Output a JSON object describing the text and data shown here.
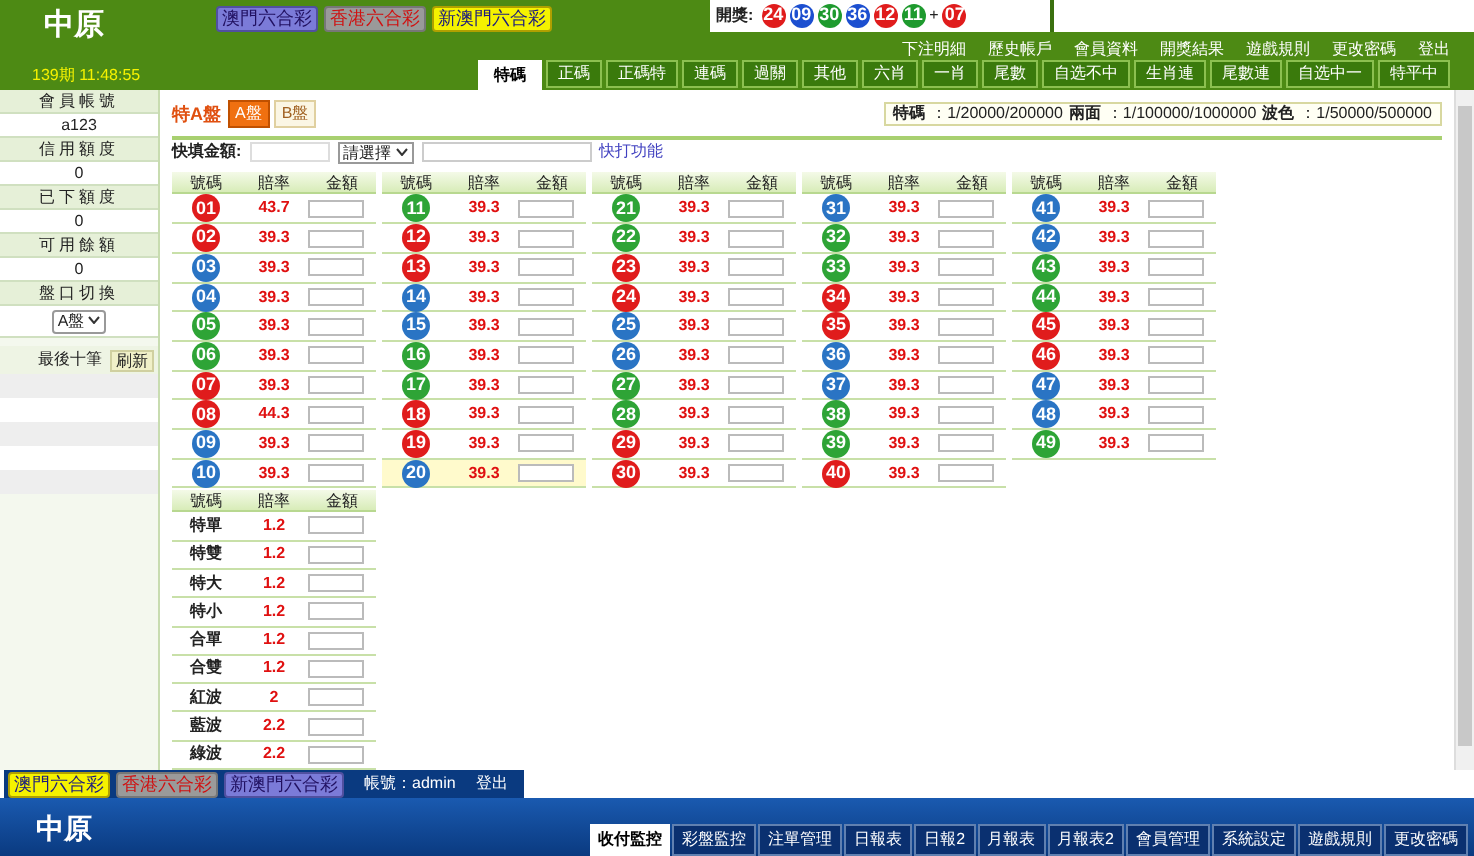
{
  "header": {
    "logo": "中原",
    "period": "139期 11:48:55",
    "lottery_badges": [
      {
        "label": "澳門六合彩",
        "selected": false
      },
      {
        "label": "香港六合彩",
        "selected": false
      },
      {
        "label": "新澳門六合彩",
        "selected": true
      }
    ],
    "draw": {
      "label": "開獎:",
      "plus": "+",
      "balls": [
        {
          "number": "24",
          "color": "#e01c1c"
        },
        {
          "number": "09",
          "color": "#1c4fd0"
        },
        {
          "number": "30",
          "color": "#1e9a2e"
        },
        {
          "number": "36",
          "color": "#1c4fd0"
        },
        {
          "number": "12",
          "color": "#e01c1c"
        },
        {
          "number": "11",
          "color": "#1e9a2e"
        },
        {
          "number": "07",
          "color": "#e01c1c"
        }
      ]
    },
    "links": [
      "下注明細",
      "歷史帳戶",
      "會員資料",
      "開獎結果",
      "遊戲規則",
      "更改密碼",
      "登出"
    ],
    "tabs": [
      {
        "label": "特碼",
        "selected": true
      },
      {
        "label": "正碼",
        "selected": false
      },
      {
        "label": "正碼特",
        "selected": false
      },
      {
        "label": "連碼",
        "selected": false
      },
      {
        "label": "過關",
        "selected": false
      },
      {
        "label": "其他",
        "selected": false
      },
      {
        "label": "六肖",
        "selected": false
      },
      {
        "label": "一肖",
        "selected": false
      },
      {
        "label": "尾數",
        "selected": false
      },
      {
        "label": "自选不中",
        "selected": false
      },
      {
        "label": "生肖連",
        "selected": false
      },
      {
        "label": "尾數連",
        "selected": false
      },
      {
        "label": "自选中一",
        "selected": false
      },
      {
        "label": "特平中",
        "selected": false
      }
    ]
  },
  "sidebar": {
    "fields": [
      {
        "label": "會員帳號",
        "value": "a123"
      },
      {
        "label": "信用額度",
        "value": "0"
      },
      {
        "label": "已下額度",
        "value": "0"
      },
      {
        "label": "可用餘額",
        "value": "0"
      }
    ],
    "plate_switch": {
      "label": "盤口切換",
      "value": "A盤"
    },
    "recent": {
      "title": "最後十筆",
      "button": "刷新"
    }
  },
  "main": {
    "title": "特A盤",
    "plates": [
      {
        "label": "A盤",
        "selected": true
      },
      {
        "label": "B盤",
        "selected": false
      }
    ],
    "quick_fill": {
      "label": "快填金額:",
      "select": "請選擇",
      "link": "快打功能"
    },
    "limits": [
      {
        "label": "特碼",
        "value": "：1/20000/200000"
      },
      {
        "label": "兩面",
        "value": "：1/100000/1000000"
      },
      {
        "label": "波色",
        "value": "：1/50000/500000"
      }
    ],
    "number_tables": [
      {
        "columns": [
          "號碼",
          "賠率",
          "金額"
        ],
        "rows": [
          {
            "number": "01",
            "color": "#e01c1c",
            "odds": "43.7",
            "selected": false
          },
          {
            "number": "02",
            "color": "#e01c1c",
            "odds": "39.3",
            "selected": false
          },
          {
            "number": "03",
            "color": "#2a74c4",
            "odds": "39.3",
            "selected": false
          },
          {
            "number": "04",
            "color": "#2a74c4",
            "odds": "39.3",
            "selected": false
          },
          {
            "number": "05",
            "color": "#2ea436",
            "odds": "39.3",
            "selected": false
          },
          {
            "number": "06",
            "color": "#2ea436",
            "odds": "39.3",
            "selected": false
          },
          {
            "number": "07",
            "color": "#e01c1c",
            "odds": "39.3",
            "selected": false
          },
          {
            "number": "08",
            "color": "#e01c1c",
            "odds": "44.3",
            "selected": false
          },
          {
            "number": "09",
            "color": "#2a74c4",
            "odds": "39.3",
            "selected": false
          },
          {
            "number": "10",
            "color": "#2a74c4",
            "odds": "39.3",
            "selected": false
          }
        ]
      },
      {
        "columns": [
          "號碼",
          "賠率",
          "金額"
        ],
        "rows": [
          {
            "number": "11",
            "color": "#2ea436",
            "odds": "39.3",
            "selected": false
          },
          {
            "number": "12",
            "color": "#e01c1c",
            "odds": "39.3",
            "selected": false
          },
          {
            "number": "13",
            "color": "#e01c1c",
            "odds": "39.3",
            "selected": false
          },
          {
            "number": "14",
            "color": "#2a74c4",
            "odds": "39.3",
            "selected": false
          },
          {
            "number": "15",
            "color": "#2a74c4",
            "odds": "39.3",
            "selected": false
          },
          {
            "number": "16",
            "color": "#2ea436",
            "odds": "39.3",
            "selected": false
          },
          {
            "number": "17",
            "color": "#2ea436",
            "odds": "39.3",
            "selected": false
          },
          {
            "number": "18",
            "color": "#e01c1c",
            "odds": "39.3",
            "selected": false
          },
          {
            "number": "19",
            "color": "#e01c1c",
            "odds": "39.3",
            "selected": false
          },
          {
            "number": "20",
            "color": "#2a74c4",
            "odds": "39.3",
            "selected": true
          }
        ]
      },
      {
        "columns": [
          "號碼",
          "賠率",
          "金額"
        ],
        "rows": [
          {
            "number": "21",
            "color": "#2ea436",
            "odds": "39.3",
            "selected": false
          },
          {
            "number": "22",
            "color": "#2ea436",
            "odds": "39.3",
            "selected": false
          },
          {
            "number": "23",
            "color": "#e01c1c",
            "odds": "39.3",
            "selected": false
          },
          {
            "number": "24",
            "color": "#e01c1c",
            "odds": "39.3",
            "selected": false
          },
          {
            "number": "25",
            "color": "#2a74c4",
            "odds": "39.3",
            "selected": false
          },
          {
            "number": "26",
            "color": "#2a74c4",
            "odds": "39.3",
            "selected": false
          },
          {
            "number": "27",
            "color": "#2ea436",
            "odds": "39.3",
            "selected": false
          },
          {
            "number": "28",
            "color": "#2ea436",
            "odds": "39.3",
            "selected": false
          },
          {
            "number": "29",
            "color": "#e01c1c",
            "odds": "39.3",
            "selected": false
          },
          {
            "number": "30",
            "color": "#e01c1c",
            "odds": "39.3",
            "selected": false
          }
        ]
      },
      {
        "columns": [
          "號碼",
          "賠率",
          "金額"
        ],
        "rows": [
          {
            "number": "31",
            "color": "#2a74c4",
            "odds": "39.3",
            "selected": false
          },
          {
            "number": "32",
            "color": "#2ea436",
            "odds": "39.3",
            "selected": false
          },
          {
            "number": "33",
            "color": "#2ea436",
            "odds": "39.3",
            "selected": false
          },
          {
            "number": "34",
            "color": "#e01c1c",
            "odds": "39.3",
            "selected": false
          },
          {
            "number": "35",
            "color": "#e01c1c",
            "odds": "39.3",
            "selected": false
          },
          {
            "number": "36",
            "color": "#2a74c4",
            "odds": "39.3",
            "selected": false
          },
          {
            "number": "37",
            "color": "#2a74c4",
            "odds": "39.3",
            "selected": false
          },
          {
            "number": "38",
            "color": "#2ea436",
            "odds": "39.3",
            "selected": false
          },
          {
            "number": "39",
            "color": "#2ea436",
            "odds": "39.3",
            "selected": false
          },
          {
            "number": "40",
            "color": "#e01c1c",
            "odds": "39.3",
            "selected": false
          }
        ]
      },
      {
        "columns": [
          "號碼",
          "賠率",
          "金額"
        ],
        "rows": [
          {
            "number": "41",
            "color": "#2a74c4",
            "odds": "39.3",
            "selected": false
          },
          {
            "number": "42",
            "color": "#2a74c4",
            "odds": "39.3",
            "selected": false
          },
          {
            "number": "43",
            "color": "#2ea436",
            "odds": "39.3",
            "selected": false
          },
          {
            "number": "44",
            "color": "#2ea436",
            "odds": "39.3",
            "selected": false
          },
          {
            "number": "45",
            "color": "#e01c1c",
            "odds": "39.3",
            "selected": false
          },
          {
            "number": "46",
            "color": "#e01c1c",
            "odds": "39.3",
            "selected": false
          },
          {
            "number": "47",
            "color": "#2a74c4",
            "odds": "39.3",
            "selected": false
          },
          {
            "number": "48",
            "color": "#2a74c4",
            "odds": "39.3",
            "selected": false
          },
          {
            "number": "49",
            "color": "#2ea436",
            "odds": "39.3",
            "selected": false
          }
        ]
      }
    ],
    "option_columns": [
      "號碼",
      "賠率",
      "金額"
    ],
    "option_rows": [
      {
        "label": "特單",
        "odds": "1.2"
      },
      {
        "label": "特雙",
        "odds": "1.2"
      },
      {
        "label": "特大",
        "odds": "1.2"
      },
      {
        "label": "特小",
        "odds": "1.2"
      },
      {
        "label": "合單",
        "odds": "1.2"
      },
      {
        "label": "合雙",
        "odds": "1.2"
      },
      {
        "label": "紅波",
        "odds": "2"
      },
      {
        "label": "藍波",
        "odds": "2.2"
      },
      {
        "label": "綠波",
        "odds": "2.2"
      }
    ]
  },
  "admin_bar": {
    "logo": "中原",
    "account": "帳號：admin",
    "logout": "登出",
    "lottery_badges": [
      {
        "label": "澳門六合彩",
        "selected": true
      },
      {
        "label": "香港六合彩",
        "selected": false
      },
      {
        "label": "新澳門六合彩",
        "selected": false
      }
    ],
    "tabs": [
      {
        "label": "收付監控",
        "selected": true
      },
      {
        "label": "彩盤監控",
        "selected": false
      },
      {
        "label": "注單管理",
        "selected": false
      },
      {
        "label": "日報表",
        "selected": false
      },
      {
        "label": "日報2",
        "selected": false
      },
      {
        "label": "月報表",
        "selected": false
      },
      {
        "label": "月報表2",
        "selected": false
      },
      {
        "label": "會員管理",
        "selected": false
      },
      {
        "label": "系統設定",
        "selected": false
      },
      {
        "label": "遊戲規則",
        "selected": false
      },
      {
        "label": "更改密碼",
        "selected": false
      }
    ]
  }
}
